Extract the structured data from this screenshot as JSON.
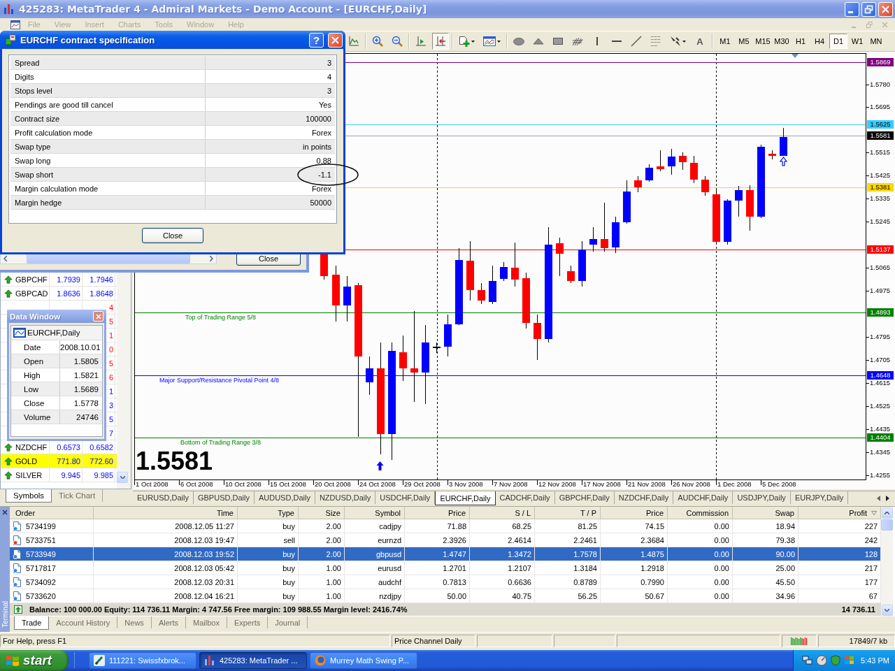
{
  "window": {
    "title": "425283: MetaTrader 4 - Admiral Markets - Demo Account - [EURCHF,Daily]",
    "active": false
  },
  "menu": [
    {
      "label": "File",
      "disabled": true
    },
    {
      "label": "View",
      "disabled": true
    },
    {
      "label": "Insert",
      "disabled": true
    },
    {
      "label": "Charts",
      "disabled": true
    },
    {
      "label": "Tools",
      "disabled": true
    },
    {
      "label": "Window",
      "disabled": true
    },
    {
      "label": "Help",
      "disabled": true
    }
  ],
  "toolbar": {
    "groups": [
      [
        {
          "kind": "line-chart",
          "pressed": false
        }
      ],
      [
        {
          "kind": "zoom-in",
          "pressed": false
        },
        {
          "kind": "zoom-out",
          "pressed": false
        }
      ],
      [
        {
          "kind": "chart-shift",
          "pressed": false
        },
        {
          "kind": "auto-scroll",
          "pressed": true
        }
      ],
      [
        {
          "kind": "new-order",
          "pressed": false
        },
        {
          "kind": "templates",
          "pressed": false
        }
      ],
      [
        {
          "kind": "ellipse",
          "pressed": false
        },
        {
          "kind": "triangle",
          "pressed": false
        },
        {
          "kind": "rectangle",
          "pressed": false
        },
        {
          "kind": "hatch-lines",
          "pressed": false
        },
        {
          "kind": "vertical-line",
          "pressed": false
        },
        {
          "kind": "horizontal-line",
          "pressed": false
        },
        {
          "kind": "trend-line",
          "pressed": false
        },
        {
          "kind": "fibonacci",
          "pressed": false
        },
        {
          "kind": "arrows",
          "pressed": false
        },
        {
          "kind": "text",
          "label": "A",
          "pressed": false
        }
      ]
    ],
    "timeframes": [
      {
        "label": "M1",
        "selected": false
      },
      {
        "label": "M5",
        "selected": false
      },
      {
        "label": "M15",
        "selected": false
      },
      {
        "label": "M30",
        "selected": false
      },
      {
        "label": "H1",
        "selected": false
      },
      {
        "label": "H4",
        "selected": false
      },
      {
        "label": "D1",
        "selected": true
      },
      {
        "label": "W1",
        "selected": false
      },
      {
        "label": "MN",
        "selected": false
      }
    ]
  },
  "contract_dialog": {
    "title": "EURCHF contract specification",
    "help": "?",
    "rows": [
      {
        "label": "Spread",
        "value": "3",
        "circled": false
      },
      {
        "label": "Digits",
        "value": "4",
        "circled": false
      },
      {
        "label": "Stops level",
        "value": "3",
        "circled": false
      },
      {
        "label": "Pendings are good till cancel",
        "value": "Yes",
        "circled": false
      },
      {
        "label": "Contract size",
        "value": "100000",
        "circled": false
      },
      {
        "label": "Profit calculation mode",
        "value": "Forex",
        "circled": false
      },
      {
        "label": "Swap type",
        "value": "in points",
        "circled": false
      },
      {
        "label": "Swap long",
        "value": "0.88",
        "circled": false
      },
      {
        "label": "Swap short",
        "value": "-1.1",
        "circled": true
      },
      {
        "label": "Margin calculation mode",
        "value": "Forex",
        "circled": false
      },
      {
        "label": "Margin hedge",
        "value": "50000",
        "circled": false
      }
    ],
    "button": "Close"
  },
  "background_window": {
    "button": "Close"
  },
  "market_watch": {
    "rows": [
      {
        "symbol": "GBPCHF",
        "bid": "1.7939",
        "ask": "1.7946",
        "kind": "up",
        "highlighted": false
      },
      {
        "symbol": "GBPCAD",
        "bid": "1.8636",
        "ask": "1.8648",
        "kind": "up",
        "highlighted": false
      },
      {
        "ask": "4",
        "kind": "down",
        "highlighted": false
      },
      {
        "ask": "5",
        "kind": "down",
        "highlighted": false
      },
      {
        "ask": "1",
        "kind": "down",
        "highlighted": false
      },
      {
        "ask": "0",
        "kind": "down",
        "highlighted": false
      },
      {
        "ask": "5",
        "kind": "down",
        "highlighted": false
      },
      {
        "ask": "6",
        "kind": "down",
        "highlighted": false
      },
      {
        "ask": "1",
        "kind": "up",
        "highlighted": false
      },
      {
        "ask": "3",
        "kind": "up",
        "highlighted": false
      },
      {
        "ask": "5",
        "kind": "up",
        "highlighted": false
      },
      {
        "ask": "7",
        "kind": "up",
        "highlighted": false
      },
      {
        "symbol": "NZDCHF",
        "bid": "0.6573",
        "ask": "0.6582",
        "kind": "up",
        "highlighted": false
      },
      {
        "symbol": "GOLD",
        "bid": "771.80",
        "ask": "772.60",
        "kind": "up",
        "highlighted": true
      },
      {
        "symbol": "SILVER",
        "bid": "9.945",
        "ask": "9.985",
        "kind": "up",
        "highlighted": false
      }
    ],
    "tabs": [
      {
        "label": "Symbols",
        "selected": true
      },
      {
        "label": "Tick Chart",
        "selected": false
      }
    ]
  },
  "data_window": {
    "title": "Data Window",
    "header": "EURCHF,Daily",
    "rows": [
      {
        "label": "Date",
        "value": "2008.10.01"
      },
      {
        "label": "Open",
        "value": "1.5805"
      },
      {
        "label": "High",
        "value": "1.5821"
      },
      {
        "label": "Low",
        "value": "1.5689"
      },
      {
        "label": "Close",
        "value": "1.5778"
      },
      {
        "label": "Volume",
        "value": "24746"
      }
    ]
  },
  "chart": {
    "price_ticks": [
      "1.5780",
      "1.5695",
      "1.5515",
      "1.5425",
      "1.5335",
      "1.5245",
      "1.5065",
      "1.4975",
      "1.4795",
      "1.4705",
      "1.4615",
      "1.4525",
      "1.4435",
      "1.4345",
      "1.4255"
    ],
    "levels": [
      {
        "price": "1.5869",
        "color": "#800080",
        "kind": "level"
      },
      {
        "price": "1.5625",
        "color": "#33ccff",
        "kind": "level"
      },
      {
        "price": "1.5581",
        "color": "#000000",
        "kind": "bid"
      },
      {
        "price": "1.5381",
        "color": "#ffd700",
        "kind": "level"
      },
      {
        "price": "1.5137",
        "color": "#ff0000",
        "kind": "level"
      },
      {
        "price": "1.4893",
        "color": "#008000",
        "kind": "level",
        "label": "Top of Trading Range  5/8"
      },
      {
        "price": "1.4648",
        "color": "#0000ff",
        "kind": "level",
        "label": "Major Support/Resistance Pivotal Point  4/8"
      },
      {
        "price": "1.4404",
        "color": "#008000",
        "kind": "level",
        "label": "Bottom of Trading Range  3/8"
      }
    ],
    "last_price": "1.5581",
    "dates": [
      "1 Oct 2008",
      "6 Oct 2008",
      "10 Oct 2008",
      "15 Oct 2008",
      "20 Oct 2008",
      "24 Oct 2008",
      "29 Oct 2008",
      "3 Nov 2008",
      "7 Nov 2008",
      "12 Nov 2008",
      "17 Nov 2008",
      "21 Nov 2008",
      "26 Nov 2008",
      "1 Dec 2008",
      "5 Dec 2008"
    ]
  },
  "chart_tabs": [
    {
      "label": "EURUSD,Daily",
      "selected": false
    },
    {
      "label": "GBPUSD,Daily",
      "selected": false
    },
    {
      "label": "AUDUSD,Daily",
      "selected": false
    },
    {
      "label": "NZDUSD,Daily",
      "selected": false
    },
    {
      "label": "USDCHF,Daily",
      "selected": false
    },
    {
      "label": "EURCHF,Daily",
      "selected": true
    },
    {
      "label": "CADCHF,Daily",
      "selected": false
    },
    {
      "label": "GBPCHF,Daily",
      "selected": false
    },
    {
      "label": "NZDCHF,Daily",
      "selected": false
    },
    {
      "label": "AUDCHF,Daily",
      "selected": false
    },
    {
      "label": "USDJPY,Daily",
      "selected": false
    },
    {
      "label": "EURJPY,Daily",
      "selected": false
    }
  ],
  "terminal": {
    "title": "Terminal",
    "columns": [
      "Order",
      "Time",
      "Type",
      "Size",
      "Symbol",
      "Price",
      "S / L",
      "T / P",
      "Price",
      "Commission",
      "Swap",
      "Profit"
    ],
    "rows": [
      {
        "kind": "buy",
        "selected": false,
        "cells": [
          "5734199",
          "2008.12.05 11:27",
          "buy",
          "2.00",
          "cadjpy",
          "71.88",
          "68.25",
          "81.25",
          "74.15",
          "0.00",
          "18.94",
          "227"
        ]
      },
      {
        "kind": "sell",
        "selected": false,
        "cells": [
          "5733751",
          "2008.12.03 19:47",
          "sell",
          "2.00",
          "eurnzd",
          "2.3926",
          "2.4614",
          "2.2461",
          "2.3684",
          "0.00",
          "79.38",
          "242"
        ]
      },
      {
        "kind": "buy",
        "selected": true,
        "cells": [
          "5733949",
          "2008.12.03 19:52",
          "buy",
          "2.00",
          "gbpusd",
          "1.4747",
          "1.3472",
          "1.7578",
          "1.4875",
          "0.00",
          "90.00",
          "128"
        ]
      },
      {
        "kind": "buy",
        "selected": false,
        "cells": [
          "5717817",
          "2008.12.03 05:42",
          "buy",
          "1.00",
          "eurusd",
          "1.2701",
          "1.2107",
          "1.3184",
          "1.2918",
          "0.00",
          "25.00",
          "217"
        ]
      },
      {
        "kind": "buy",
        "selected": false,
        "cells": [
          "5734092",
          "2008.12.03 20:31",
          "buy",
          "1.00",
          "audchf",
          "0.7813",
          "0.6636",
          "0.8789",
          "0.7990",
          "0.00",
          "45.50",
          "177"
        ]
      },
      {
        "kind": "buy",
        "selected": false,
        "cells": [
          "5733620",
          "2008.12.04 16:21",
          "buy",
          "1.00",
          "nzdjpy",
          "50.00",
          "40.75",
          "56.25",
          "50.67",
          "0.00",
          "34.96",
          "67"
        ]
      }
    ],
    "summary": "Balance: 100 000.00  Equity: 114 736.11  Margin: 4 747.56  Free margin: 109 988.55  Margin level: 2416.74%",
    "total": "14 736.11",
    "tabs": [
      {
        "label": "Trade",
        "selected": true
      },
      {
        "label": "Account History",
        "selected": false
      },
      {
        "label": "News",
        "selected": false
      },
      {
        "label": "Alerts",
        "selected": false
      },
      {
        "label": "Mailbox",
        "selected": false
      },
      {
        "label": "Experts",
        "selected": false
      },
      {
        "label": "Journal",
        "selected": false
      }
    ]
  },
  "status_bar": {
    "help": "For Help, press F1",
    "indicator": "Price Channel Daily",
    "traffic": "17849/7 kb"
  },
  "taskbar": {
    "start": "start",
    "tasks": [
      {
        "label": "111221: Swissfxbrok...",
        "kind": "tool",
        "selected": false
      },
      {
        "label": "425283: MetaTrader ...",
        "kind": "chart",
        "selected": true
      },
      {
        "label": "Murrey Math Swing P...",
        "kind": "browser",
        "selected": false
      }
    ],
    "clock": "5:43 PM"
  }
}
